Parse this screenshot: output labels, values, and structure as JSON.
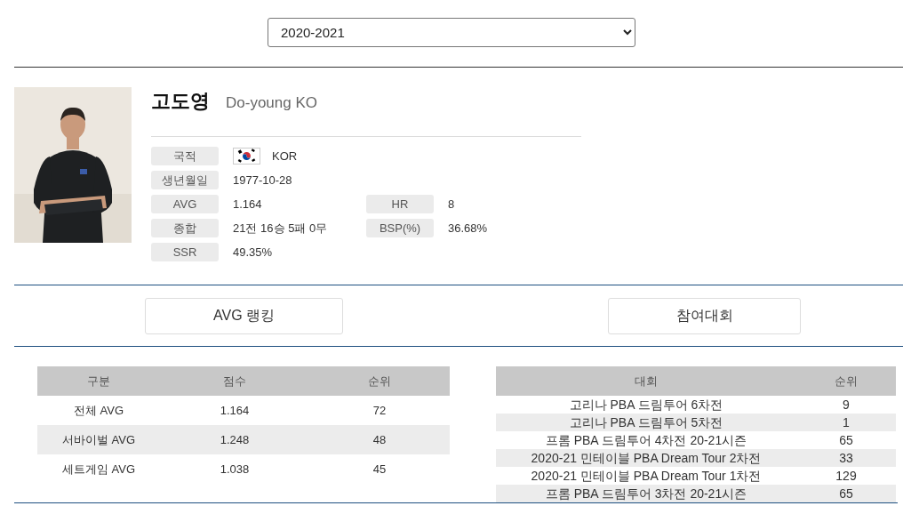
{
  "season_select": {
    "value": "2020-2021"
  },
  "player": {
    "name_ko": "고도영",
    "name_en": "Do-young KO",
    "info": [
      {
        "cells": [
          {
            "label": "국적",
            "value": "KOR",
            "kind": "flag"
          }
        ]
      },
      {
        "cells": [
          {
            "label": "생년월일",
            "value": "1977-10-28",
            "kind": "text"
          }
        ]
      },
      {
        "cells": [
          {
            "label": "AVG",
            "value": "1.164",
            "kind": "text"
          },
          {
            "label": "HR",
            "value": "8",
            "kind": "text"
          }
        ]
      },
      {
        "cells": [
          {
            "label": "종합",
            "value": "21전 16승 5패 0무",
            "kind": "text"
          },
          {
            "label": "BSP(%)",
            "value": "36.68%",
            "kind": "text"
          }
        ]
      },
      {
        "cells": [
          {
            "label": "SSR",
            "value": "49.35%",
            "kind": "text"
          }
        ]
      }
    ]
  },
  "buttons": [
    "AVG 랭킹",
    "참여대회"
  ],
  "avg_table": {
    "columns": [
      "구분",
      "점수",
      "순위"
    ],
    "rows": [
      [
        "전체 AVG",
        "1.164",
        "72"
      ],
      [
        "서바이벌 AVG",
        "1.248",
        "48"
      ],
      [
        "세트게임 AVG",
        "1.038",
        "45"
      ]
    ]
  },
  "tournament_table": {
    "columns": [
      "대회",
      "순위"
    ],
    "rows": [
      [
        "고리나 PBA 드림투어 6차전",
        "9"
      ],
      [
        "고리나 PBA 드림투어 5차전",
        "1"
      ],
      [
        "프롬 PBA 드림투어 4차전 20-21시즌",
        "65"
      ],
      [
        "2020-21 민테이블 PBA Dream Tour 2차전",
        "33"
      ],
      [
        "2020-21 민테이블 PBA Dream Tour 1차전",
        "129"
      ],
      [
        "프롬 PBA 드림투어 3차전 20-21시즌",
        "65"
      ]
    ]
  }
}
